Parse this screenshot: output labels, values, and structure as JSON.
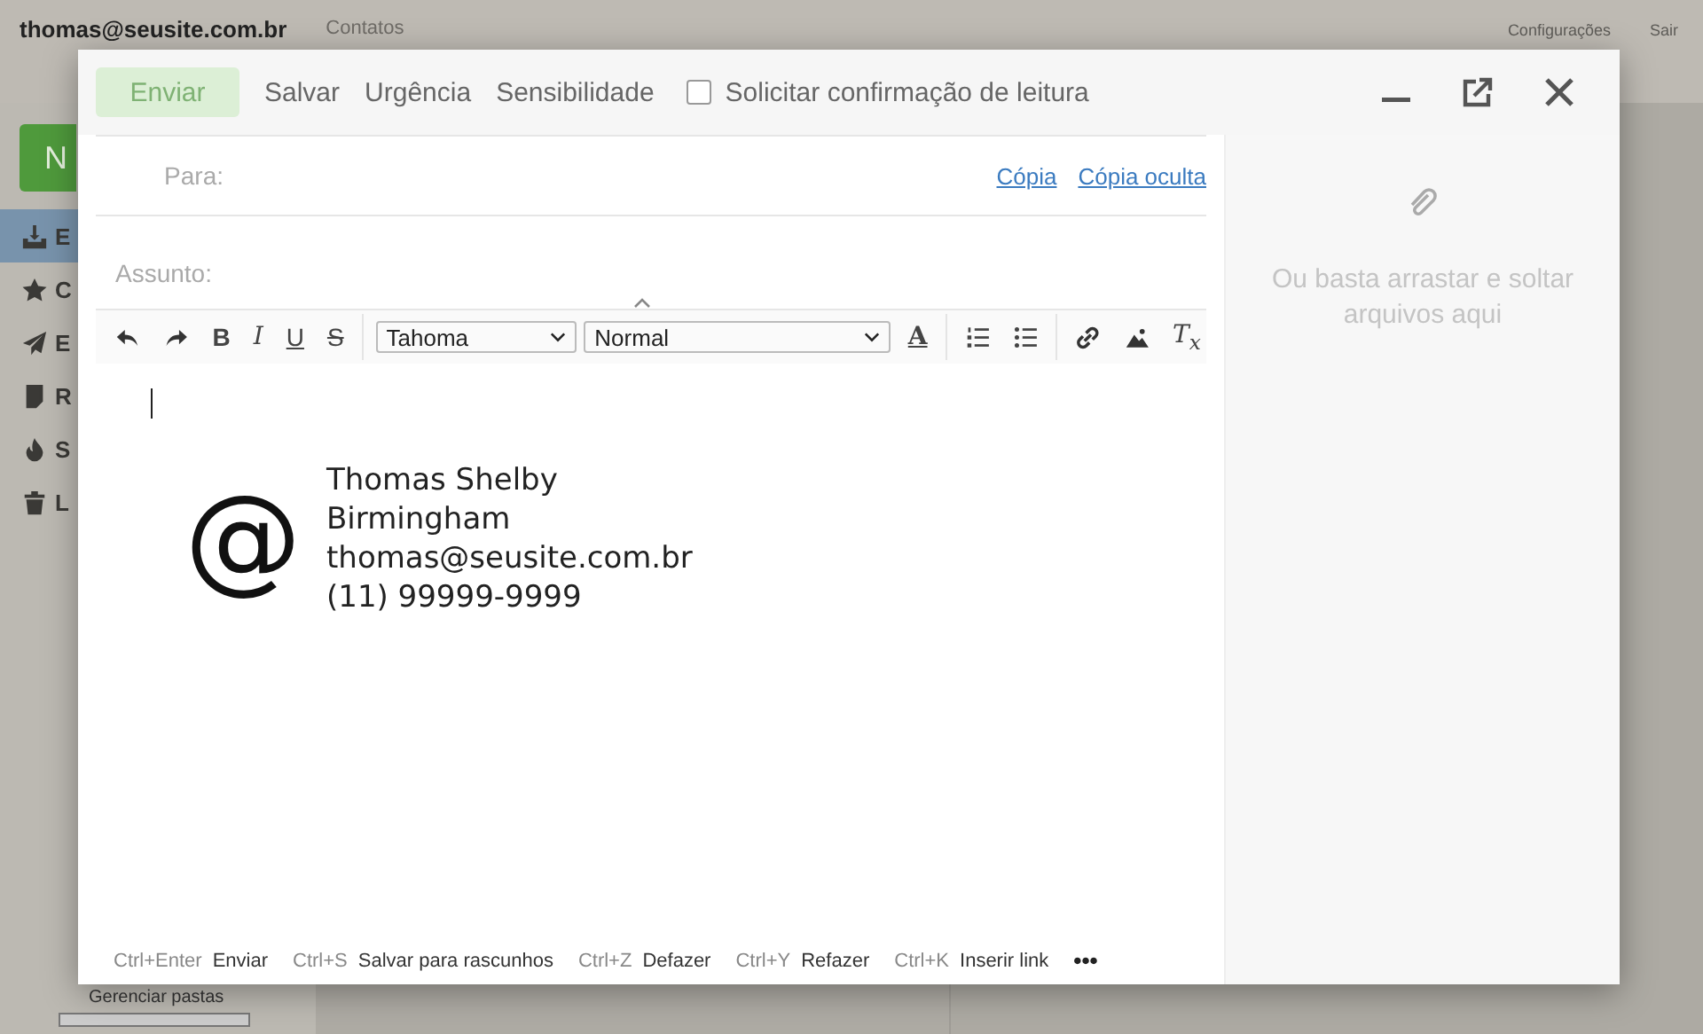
{
  "app": {
    "account": "thomas@seusite.com.br",
    "nav": [
      "Contatos"
    ],
    "settings": "Configurações",
    "logout": "Sair",
    "new_button": "N",
    "folders": [
      {
        "label": "E",
        "selected": true
      },
      {
        "label": "C",
        "selected": false
      },
      {
        "label": "E",
        "selected": false
      },
      {
        "label": "R",
        "selected": false
      },
      {
        "label": "S",
        "selected": false
      },
      {
        "label": "L",
        "selected": false
      }
    ],
    "manage_folders": "Gerenciar pastas"
  },
  "compose": {
    "actions": [
      {
        "label": "Enviar",
        "kind": "primary",
        "disabled": true
      },
      {
        "label": "Salvar",
        "kind": "text",
        "disabled": false
      },
      {
        "label": "Urgência",
        "kind": "text",
        "disabled": false
      },
      {
        "label": "Sensibilidade",
        "kind": "text",
        "disabled": false
      }
    ],
    "read_receipt": {
      "label": "Solicitar confirmação de leitura",
      "checked": false
    },
    "to_label": "Para:",
    "cc": "Cópia",
    "bcc": "Cópia oculta",
    "subject_label": "Assunto:",
    "format_buttons": [
      "B",
      "I",
      "U",
      "S"
    ],
    "font": "Tahoma",
    "size": "Normal",
    "text_color": "A",
    "clear_format": "T$_{x}$",
    "signature": {
      "symbol": "@",
      "lines": [
        "Thomas Shelby",
        "Birmingham",
        "thomas@seusite.com.br",
        "(11) 99999-9999"
      ]
    },
    "attachments": {
      "hint": "Ou basta arrastar e soltar arquivos aqui"
    },
    "shortcuts": [
      {
        "keys": "Ctrl+Enter",
        "action": "Enviar"
      },
      {
        "keys": "Ctrl+S",
        "action": "Salvar para rascunhos"
      },
      {
        "keys": "Ctrl+Z",
        "action": "Defazer"
      },
      {
        "keys": "Ctrl+Y",
        "action": "Refazer"
      },
      {
        "keys": "Ctrl+K",
        "action": "Inserir link"
      }
    ],
    "more": "•••"
  }
}
